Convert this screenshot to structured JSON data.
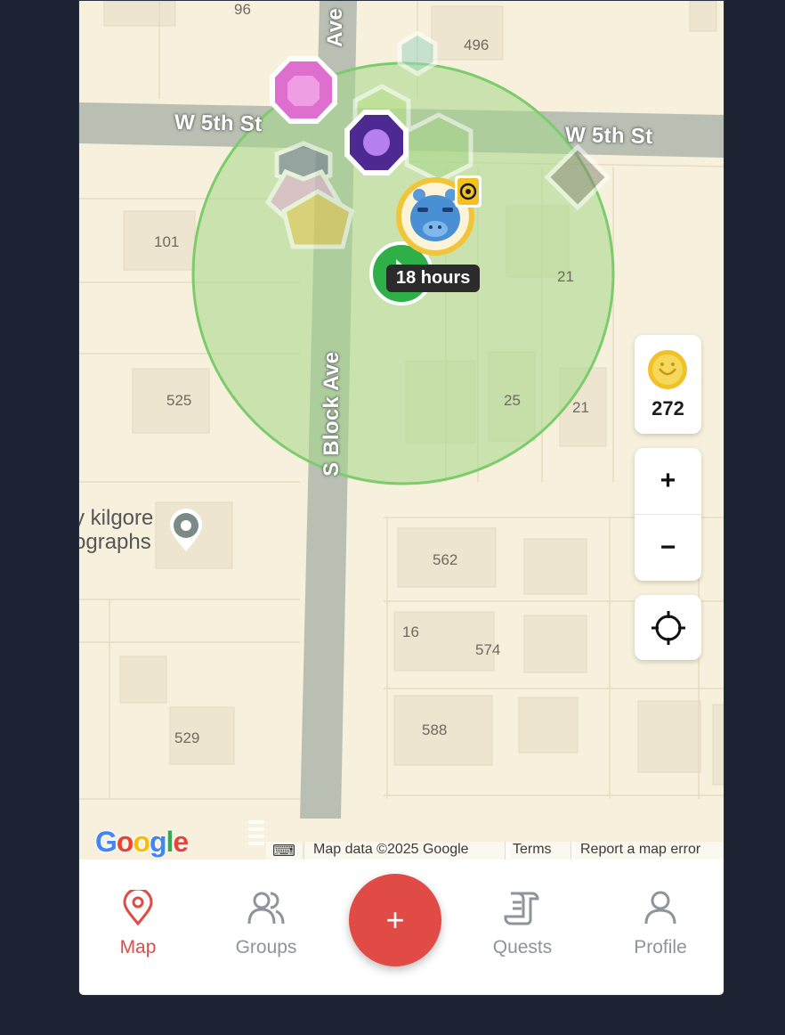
{
  "map": {
    "streets": {
      "horizontal_left": "W 5th St",
      "horizontal_right": "W 5th St",
      "vertical": "S Block Ave",
      "vertical_top": "Ave"
    },
    "building_numbers": {
      "n96": "96",
      "n496": "496",
      "n101": "101",
      "n21a": "21",
      "n525": "525",
      "n25": "25",
      "n21b": "21",
      "n562": "562",
      "n16": "16",
      "n574": "574",
      "n529": "529",
      "n588": "588"
    },
    "poi": {
      "line1": "y kilgore",
      "line2": "ographs"
    },
    "duration_badge": "18 hours",
    "attribution": {
      "keyboard": "⌨",
      "data": "Map data ©2025 Google",
      "terms": "Terms",
      "report": "Report a map error"
    },
    "google_logo": [
      "G",
      "o",
      "o",
      "g",
      "l",
      "e"
    ]
  },
  "controls": {
    "coins": "272",
    "zoom_in": "+",
    "zoom_out": "−"
  },
  "colors": {
    "accent": "#e04b46",
    "radius_fill": "#a6d889",
    "radius_stroke": "#7ccc6c"
  },
  "nav": {
    "map": "Map",
    "groups": "Groups",
    "add": "+",
    "quests": "Quests",
    "profile": "Profile"
  }
}
